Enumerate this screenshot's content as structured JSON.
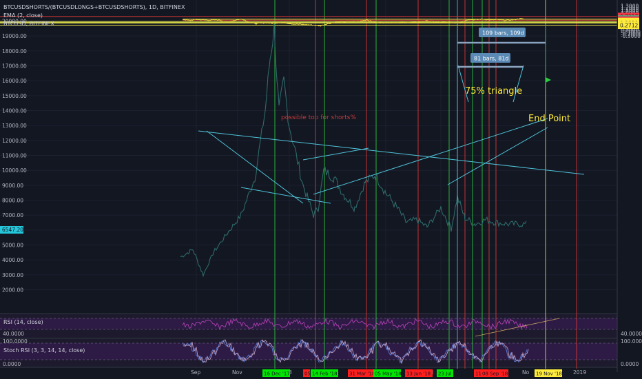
{
  "header": {
    "symbol": "BTCUSDSHORTS/(BTCUSDLONGS+BTCUSDSHORTS), 1D, BITFINEX",
    "ema": "EMA (2, close)",
    "compare": "BTCUSD, BITFINEX"
  },
  "chart_data": {
    "type": "line",
    "left_axis": {
      "ticks": [
        "20000.00",
        "19000.00",
        "18000.00",
        "17000.00",
        "16000.00",
        "15000.00",
        "14000.00",
        "13000.00",
        "12000.00",
        "11000.00",
        "10000.00",
        "9000.00",
        "8000.00",
        "7000.00",
        "6000.00",
        "5000.00",
        "4000.00",
        "3000.00",
        "2000.00"
      ],
      "badge": "6547.20"
    },
    "right_axis": {
      "ticks": [
        "1.3000",
        "1.2000",
        "1.1000",
        "1.0000",
        "0.9000",
        "0.8000",
        "0.7000",
        "0.6000",
        "0.5000",
        "0.4000",
        "0.3000",
        "0.2000",
        "0.1000",
        "0.0000",
        "-0.1000",
        "-0.2000",
        "-0.3000"
      ]
    },
    "x_axis": {
      "ticks": [
        "Sep",
        "Nov",
        "'18",
        "2019",
        "Jul",
        "No"
      ]
    },
    "price_labels": [
      {
        "text": "0.7317",
        "color": "#f23645"
      },
      {
        "text": "0.5924",
        "color": "#ffeb3b"
      },
      {
        "text": "0.5890",
        "color": "#26a69a"
      },
      {
        "text": "0.5394",
        "color": "#f23645"
      },
      {
        "text": "0.4673",
        "color": "#ffeb3b"
      },
      {
        "text": "0.4166",
        "color": "#ffeb3b"
      },
      {
        "text": "0.3828",
        "color": "#ffeb3b"
      },
      {
        "text": "0.2712",
        "color": "#ffeb3b"
      }
    ],
    "date_labels": [
      {
        "text": "16 Dec '17",
        "color": "#00e600"
      },
      {
        "text": "05",
        "color": "#ff1e1e"
      },
      {
        "text": "14 Feb '18",
        "color": "#00e600"
      },
      {
        "text": "31 Mar '18",
        "color": "#ff1e1e"
      },
      {
        "text": "05 May '18",
        "color": "#00e600"
      },
      {
        "text": "13 Jun '18",
        "color": "#ff1e1e"
      },
      {
        "text": "23 Jul",
        "color": "#00e600"
      },
      {
        "text": "11 Aug",
        "color": "#ff1e1e"
      },
      {
        "text": "08 Sep '18",
        "color": "#ff1e1e"
      },
      {
        "text": "19 Nov '18",
        "color": "#ffeb3b"
      }
    ],
    "annotations": {
      "bars_109": "109 bars, 109d",
      "bars_81": "81 bars, 81d",
      "triangle": "75% triangle",
      "end_point": "End Point",
      "possible_top": "possible top for shorts%"
    },
    "rsi": {
      "title": "RSI (14, close)",
      "tick": "40.0000",
      "right_tick": "40.0000"
    },
    "stoch": {
      "title": "Stoch RSI (3, 3, 14, 14, close)",
      "tick_top": "100.0000",
      "tick_bottom": "0.0000",
      "right_top": "100.0000",
      "right_bottom": "0.0000"
    },
    "colors": {
      "ratio_line": "#e6cf3a",
      "btc_line": "#2e6b6b",
      "trend": "#4fc3d8",
      "green": "#2ecc40",
      "red": "#e53935",
      "yellow": "#e6e64d",
      "rsi_line": "#b040b0",
      "stoch_k": "#5b7bd5",
      "stoch_d": "#c0a0c0"
    }
  }
}
